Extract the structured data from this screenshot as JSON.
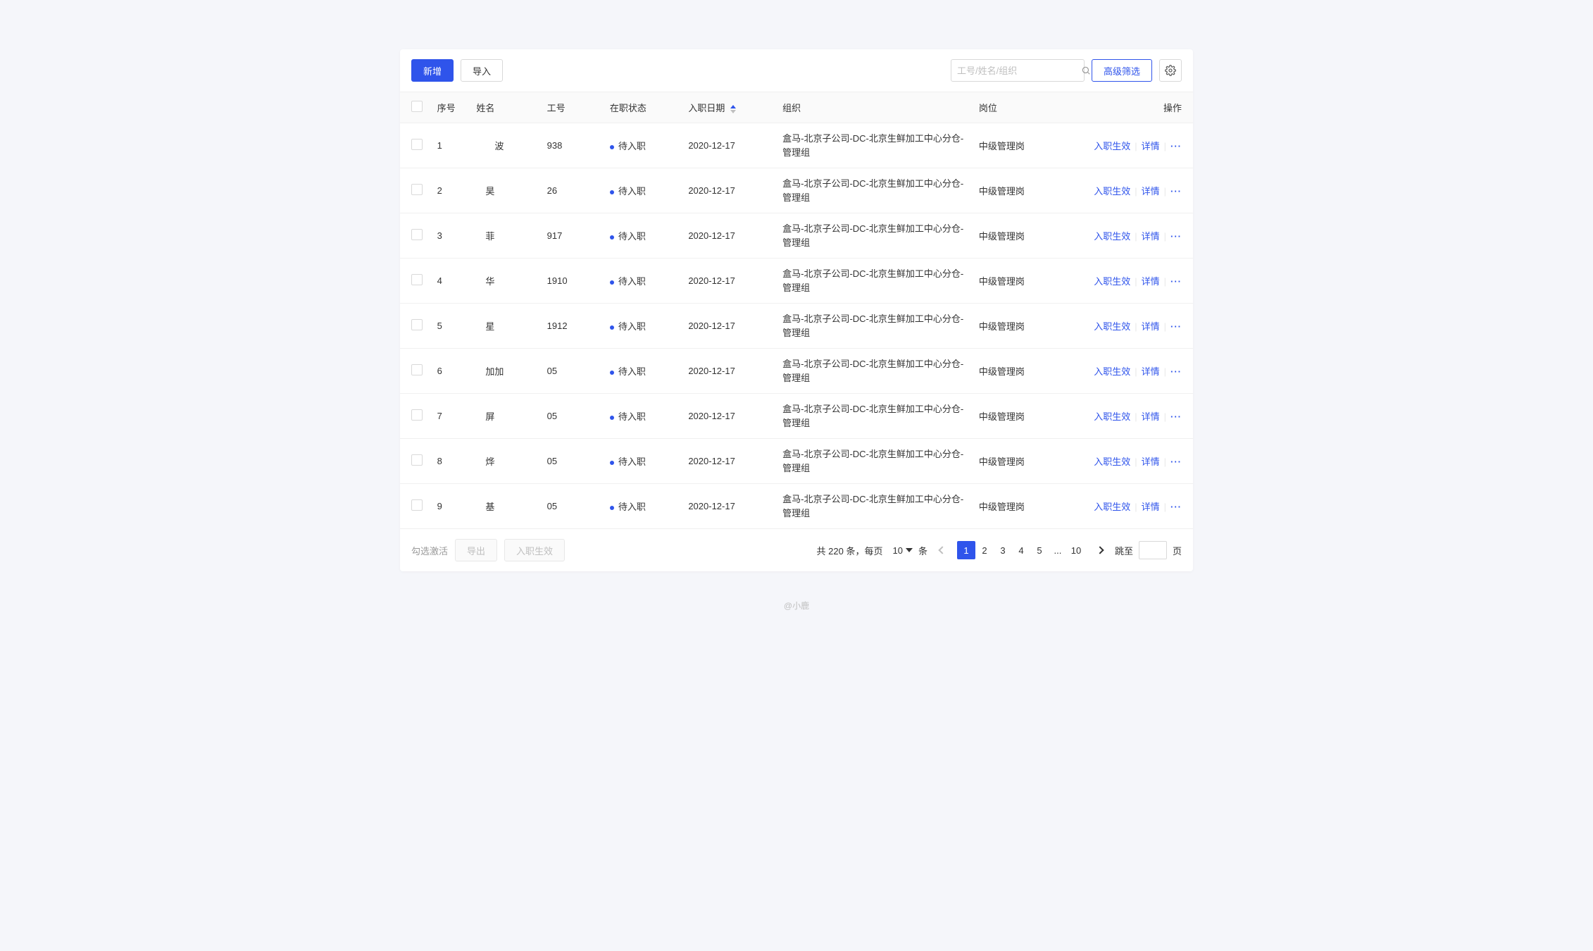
{
  "toolbar": {
    "add_label": "新增",
    "import_label": "导入",
    "search_placeholder": "工号/姓名/组织",
    "filter_label": "高级筛选"
  },
  "columns": {
    "seq": "序号",
    "name": "姓名",
    "emp_id": "工号",
    "status": "在职状态",
    "hire_date": "入职日期",
    "org": "组织",
    "job": "岗位",
    "action": "操作"
  },
  "rows": [
    {
      "seq": "1",
      "name": "　　波",
      "emp_id": "938",
      "status": "待入职",
      "hire_date": "2020-12-17",
      "org": "盒马-北京子公司-DC-北京生鲜加工中心分仓-管理组",
      "job": "中级管理岗"
    },
    {
      "seq": "2",
      "name": "　昊",
      "emp_id": "26",
      "status": "待入职",
      "hire_date": "2020-12-17",
      "org": "盒马-北京子公司-DC-北京生鲜加工中心分仓-管理组",
      "job": "中级管理岗"
    },
    {
      "seq": "3",
      "name": "　菲",
      "emp_id": "917",
      "status": "待入职",
      "hire_date": "2020-12-17",
      "org": "盒马-北京子公司-DC-北京生鲜加工中心分仓-管理组",
      "job": "中级管理岗"
    },
    {
      "seq": "4",
      "name": "　华",
      "emp_id": "1910",
      "status": "待入职",
      "hire_date": "2020-12-17",
      "org": "盒马-北京子公司-DC-北京生鲜加工中心分仓-管理组",
      "job": "中级管理岗"
    },
    {
      "seq": "5",
      "name": "　星",
      "emp_id": "1912",
      "status": "待入职",
      "hire_date": "2020-12-17",
      "org": "盒马-北京子公司-DC-北京生鲜加工中心分仓-管理组",
      "job": "中级管理岗"
    },
    {
      "seq": "6",
      "name": "　加加",
      "emp_id": "05",
      "status": "待入职",
      "hire_date": "2020-12-17",
      "org": "盒马-北京子公司-DC-北京生鲜加工中心分仓-管理组",
      "job": "中级管理岗"
    },
    {
      "seq": "7",
      "name": "　屏",
      "emp_id": "05",
      "status": "待入职",
      "hire_date": "2020-12-17",
      "org": "盒马-北京子公司-DC-北京生鲜加工中心分仓-管理组",
      "job": "中级管理岗"
    },
    {
      "seq": "8",
      "name": "　烨",
      "emp_id": "05",
      "status": "待入职",
      "hire_date": "2020-12-17",
      "org": "盒马-北京子公司-DC-北京生鲜加工中心分仓-管理组",
      "job": "中级管理岗"
    },
    {
      "seq": "9",
      "name": "　基",
      "emp_id": "05",
      "status": "待入职",
      "hire_date": "2020-12-17",
      "org": "盒马-北京子公司-DC-北京生鲜加工中心分仓-管理组",
      "job": "中级管理岗"
    }
  ],
  "row_actions": {
    "effective": "入职生效",
    "detail": "详情",
    "more": "···"
  },
  "footer": {
    "select_hint": "勾选激活",
    "export": "导出",
    "effective": "入职生效",
    "total_prefix": "共",
    "total_count": "220",
    "total_suffix": "条，每页",
    "page_size": "10",
    "unit": "条",
    "pages": [
      "1",
      "2",
      "3",
      "4",
      "5",
      "...",
      "10"
    ],
    "active_page": "1",
    "jump_label": "跳至",
    "page_suffix": "页"
  },
  "credit": "@小鹿"
}
